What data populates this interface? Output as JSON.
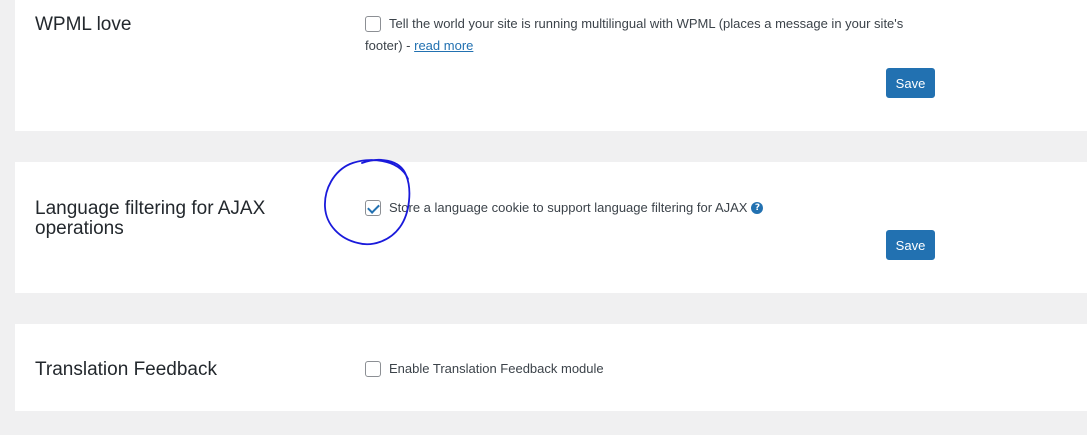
{
  "sections": {
    "wpml_love": {
      "title": "WPML love",
      "checked": false,
      "label_line1": "Tell the world your site is running multilingual with WPML (places a message in your site's",
      "label_line2_prefix": "footer) - ",
      "read_more": "read more",
      "save_label": "Save"
    },
    "ajax_filtering": {
      "title_line1": "Language filtering for AJAX",
      "title_line2": "operations",
      "checked": true,
      "label": "Store a language cookie to support language filtering for AJAX",
      "help_icon": "question-circle-icon",
      "help_glyph": "?",
      "save_label": "Save"
    },
    "translation_feedback": {
      "title": "Translation Feedback",
      "checked": false,
      "label": "Enable Translation Feedback module"
    }
  },
  "annotation": {
    "shape": "hand-drawn-circle",
    "color": "#1a1adb"
  },
  "colors": {
    "background": "#f0f0f1",
    "panel": "#ffffff",
    "primary_button": "#2271b1",
    "link": "#2271b1"
  }
}
